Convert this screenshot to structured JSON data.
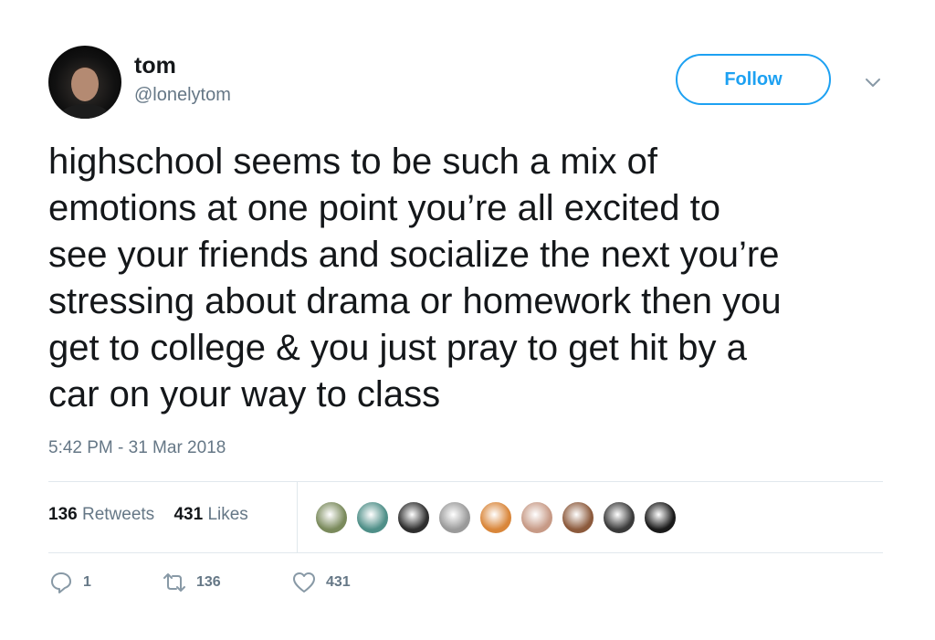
{
  "user": {
    "display_name": "tom",
    "handle": "@lonelytom"
  },
  "follow_label": "Follow",
  "tweet": {
    "lines": [
      "highschool seems to be such a mix of",
      "emotions at one point you’re all excited to",
      "see your friends and socialize the next you’re",
      "stressing about drama or homework then you",
      "get to college & you just pray to get hit by a",
      "car on your way to class"
    ],
    "timestamp": "5:42 PM - 31 Mar 2018"
  },
  "stats": {
    "retweets_count": "136",
    "retweets_label": "Retweets",
    "likes_count": "431",
    "likes_label": "Likes"
  },
  "liker_avatars": [
    {
      "color": "#7a8a5c"
    },
    {
      "color": "#4f8f88"
    },
    {
      "color": "#2e2e2e"
    },
    {
      "color": "#9a9a9a"
    },
    {
      "color": "#d9863a"
    },
    {
      "color": "#c79a86"
    },
    {
      "color": "#8c5a3c"
    },
    {
      "color": "#3a3a3a"
    },
    {
      "color": "#1a1a1a"
    }
  ],
  "actions": {
    "reply_count": "1",
    "retweet_count": "136",
    "like_count": "431"
  },
  "colors": {
    "accent": "#1da1f2",
    "secondary_text": "#657786",
    "primary_text": "#14171a",
    "divider": "#e1e8ed"
  },
  "icons": [
    "caret-down-icon",
    "reply-icon",
    "retweet-icon",
    "heart-icon"
  ]
}
